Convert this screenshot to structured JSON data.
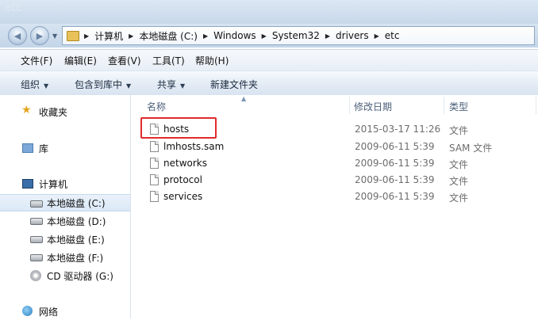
{
  "window": {
    "title": "etc"
  },
  "address": {
    "breadcrumbs": [
      "计算机",
      "本地磁盘 (C:)",
      "Windows",
      "System32",
      "drivers",
      "etc"
    ]
  },
  "menu": [
    "文件(F)",
    "编辑(E)",
    "查看(V)",
    "工具(T)",
    "帮助(H)"
  ],
  "commands": [
    {
      "label": "组织",
      "dropdown": true
    },
    {
      "label": "包含到库中",
      "dropdown": true
    },
    {
      "label": "共享",
      "dropdown": true
    },
    {
      "label": "新建文件夹",
      "dropdown": false
    }
  ],
  "sidebar": {
    "favorites": "收藏夹",
    "libraries": "库",
    "computer": "计算机",
    "drives": [
      {
        "label": "本地磁盘 (C:)",
        "selected": true
      },
      {
        "label": "本地磁盘 (D:)",
        "selected": false
      },
      {
        "label": "本地磁盘 (E:)",
        "selected": false
      },
      {
        "label": "本地磁盘 (F:)",
        "selected": false
      },
      {
        "label": "CD 驱动器 (G:)",
        "selected": false
      }
    ],
    "network": "网络"
  },
  "columns": {
    "name": "名称",
    "modified": "修改日期",
    "type": "类型"
  },
  "files": [
    {
      "name": "hosts",
      "modified": "2015-03-17 11:26",
      "type": "文件",
      "highlighted": true
    },
    {
      "name": "lmhosts.sam",
      "modified": "2009-06-11 5:39",
      "type": "SAM 文件",
      "highlighted": false
    },
    {
      "name": "networks",
      "modified": "2009-06-11 5:39",
      "type": "文件",
      "highlighted": false
    },
    {
      "name": "protocol",
      "modified": "2009-06-11 5:39",
      "type": "文件",
      "highlighted": false
    },
    {
      "name": "services",
      "modified": "2009-06-11 5:39",
      "type": "文件",
      "highlighted": false
    }
  ],
  "colors": {
    "highlight_box": "#e12b2b",
    "selection": "#dbe8f6"
  }
}
